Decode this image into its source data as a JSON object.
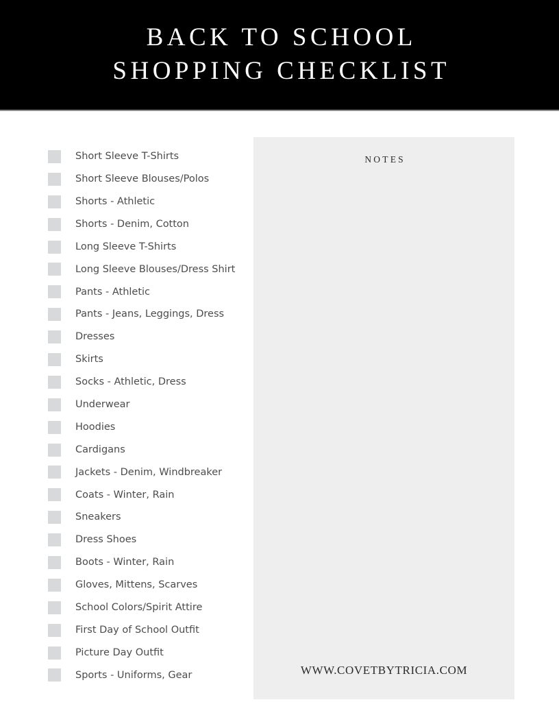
{
  "header": {
    "title_line_1": "BACK TO SCHOOL",
    "title_line_2": "SHOPPING CHECKLIST",
    "background_color": "#000000",
    "text_color": "#ffffff"
  },
  "checklist": {
    "checkbox_color": "#d8d9da",
    "label_color": "#4c4c4c",
    "items": [
      {
        "label": "Short Sleeve T-Shirts",
        "checked": false
      },
      {
        "label": "Short Sleeve Blouses/Polos",
        "checked": false
      },
      {
        "label": "Shorts - Athletic",
        "checked": false
      },
      {
        "label": "Shorts - Denim, Cotton",
        "checked": false
      },
      {
        "label": "Long Sleeve T-Shirts",
        "checked": false
      },
      {
        "label": "Long Sleeve Blouses/Dress Shirt",
        "checked": false
      },
      {
        "label": "Pants - Athletic",
        "checked": false
      },
      {
        "label": "Pants - Jeans, Leggings, Dress",
        "checked": false
      },
      {
        "label": "Dresses",
        "checked": false
      },
      {
        "label": "Skirts",
        "checked": false
      },
      {
        "label": "Socks - Athletic, Dress",
        "checked": false
      },
      {
        "label": "Underwear",
        "checked": false
      },
      {
        "label": "Hoodies",
        "checked": false
      },
      {
        "label": "Cardigans",
        "checked": false
      },
      {
        "label": "Jackets - Denim, Windbreaker",
        "checked": false
      },
      {
        "label": "Coats - Winter, Rain",
        "checked": false
      },
      {
        "label": "Sneakers",
        "checked": false
      },
      {
        "label": "Dress Shoes",
        "checked": false
      },
      {
        "label": "Boots - Winter, Rain",
        "checked": false
      },
      {
        "label": "Gloves, Mittens, Scarves",
        "checked": false
      },
      {
        "label": "School Colors/Spirit Attire",
        "checked": false
      },
      {
        "label": "First Day of School Outfit",
        "checked": false
      },
      {
        "label": "Picture Day Outfit",
        "checked": false
      },
      {
        "label": "Sports - Uniforms, Gear",
        "checked": false
      }
    ]
  },
  "notes": {
    "heading": "NOTES",
    "body_text": "",
    "footer_url": "WWW.COVETBYTRICIA.COM",
    "background_color": "#eeeeee"
  }
}
